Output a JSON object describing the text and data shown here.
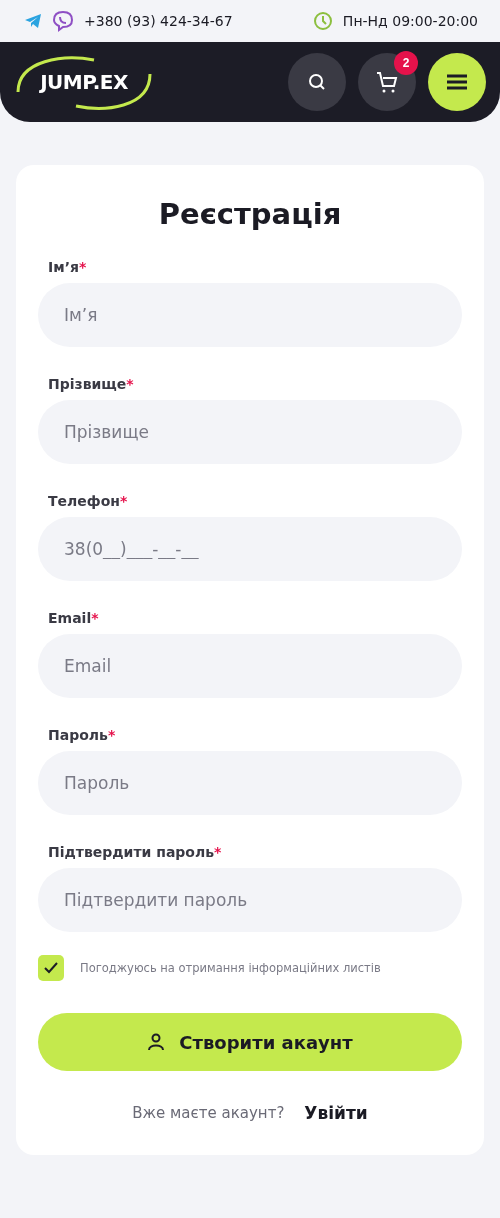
{
  "topbar": {
    "phone": "+380 (93) 424-34-67",
    "hours": "Пн-Нд 09:00-20:00"
  },
  "header": {
    "logo": "JUMP.EX",
    "cart_count": "2"
  },
  "form": {
    "title": "Реєстрація",
    "fields": [
      {
        "label": "Ім’я",
        "mark": "*",
        "placeholder": "Ім’я"
      },
      {
        "label": "Прізвище",
        "mark": "*",
        "placeholder": "Прізвище"
      },
      {
        "label": "Телефон",
        "mark": "*",
        "placeholder": "38(0__)___-__-__"
      },
      {
        "label": "Email",
        "mark": "*",
        "placeholder": "Email"
      },
      {
        "label": "Пароль",
        "mark": "*",
        "placeholder": "Пароль"
      },
      {
        "label": "Підтвердити пароль",
        "mark": "*",
        "placeholder": "Підтвердити пароль"
      }
    ],
    "newsletter": {
      "label": "Погоджуюсь на отримання інформаційних листів",
      "checked": true
    },
    "submit": "Створити акаунт",
    "login_prompt": "Вже маєте акаунт?",
    "login_link": "Увійти"
  }
}
